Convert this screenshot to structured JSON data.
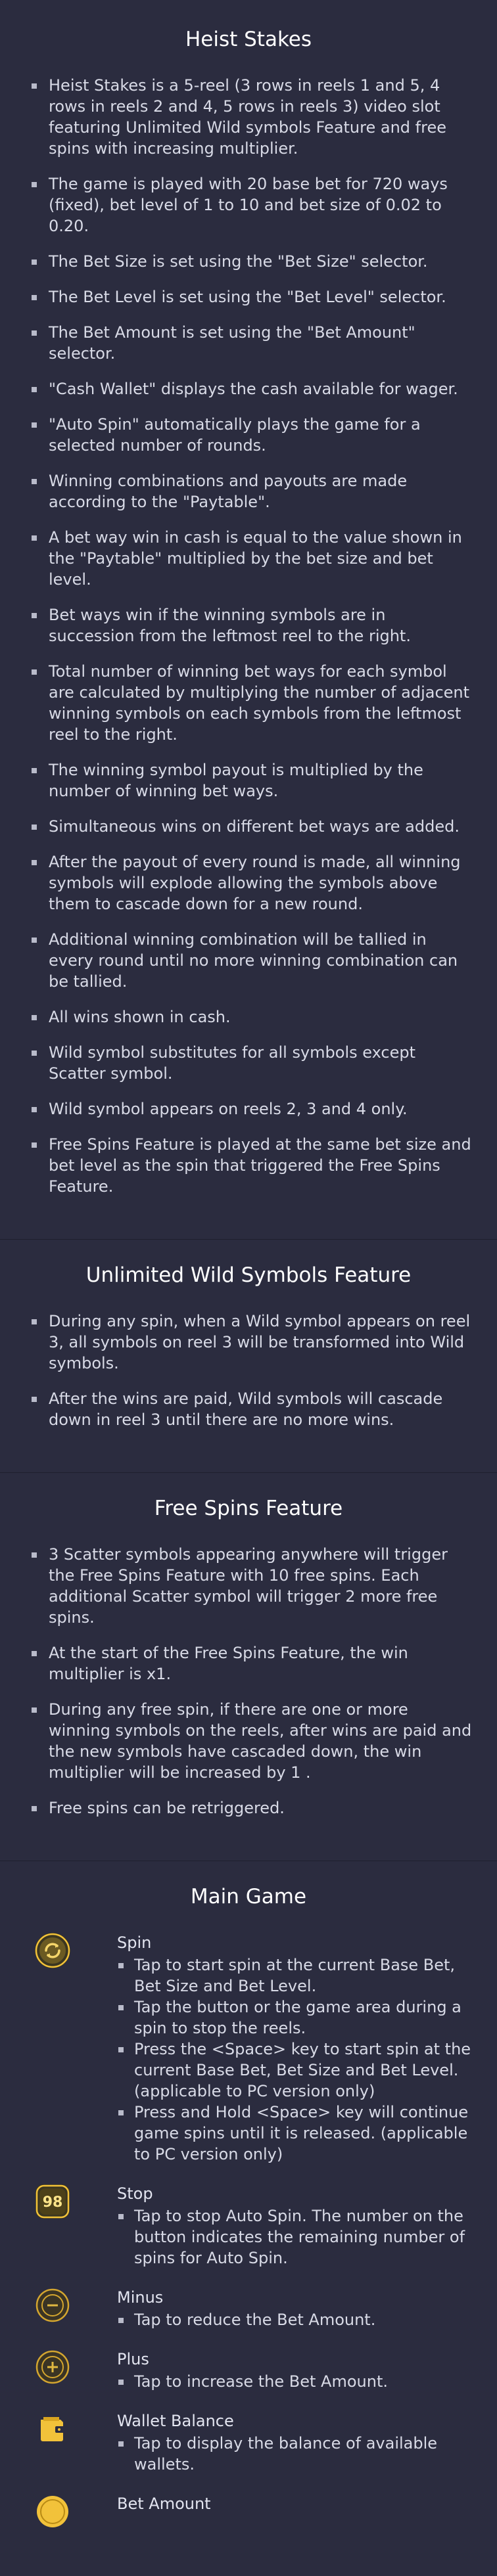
{
  "sections": {
    "heist_stakes": {
      "title": "Heist Stakes",
      "items": [
        "Heist Stakes is a 5-reel (3 rows in reels 1 and 5, 4 rows in reels 2 and 4, 5 rows in reels 3) video slot featuring Unlimited Wild symbols Feature and free spins with increasing multiplier.",
        "The game is played with 20 base bet for 720 ways (fixed), bet level of 1 to 10 and bet size of 0.02 to 0.20.",
        "The Bet Size is set using the \"Bet Size\" selector.",
        "The Bet Level is set using the \"Bet Level\" selector.",
        "The Bet Amount is set using the \"Bet Amount\" selector.",
        "\"Cash Wallet\" displays the cash available for wager.",
        "\"Auto Spin\" automatically plays the game for a selected number of rounds.",
        "Winning combinations and payouts are made according to the \"Paytable\".",
        "A bet way win in cash is equal to the value shown in the \"Paytable\" multiplied by the bet size and bet level.",
        "Bet ways win if the winning symbols are in succession from the leftmost reel to the right.",
        "Total number of winning bet ways for each symbol are calculated by multiplying the number of adjacent winning symbols on each symbols from the leftmost reel to the right.",
        "The winning symbol payout is multiplied by the number of winning bet ways.",
        "Simultaneous wins on different bet ways are added.",
        "After the payout of every round is made, all winning symbols will explode allowing the symbols above them to cascade down for a new round.",
        "Additional winning combination will be tallied in every round until no more winning combination can be tallied.",
        "All wins shown in cash.",
        "Wild symbol substitutes for all symbols except Scatter symbol.",
        "Wild symbol appears on reels 2, 3 and 4 only.",
        "Free Spins Feature is played at the same bet size and bet level as the spin that triggered the Free Spins Feature."
      ]
    },
    "unlimited_wild": {
      "title": "Unlimited Wild Symbols Feature",
      "items": [
        "During any spin, when a Wild symbol appears on reel 3, all symbols on reel 3 will be transformed into Wild symbols.",
        "After the wins are paid, Wild symbols will cascade down in reel 3 until there are no more wins."
      ]
    },
    "free_spins": {
      "title": "Free Spins Feature",
      "items": [
        "3 Scatter symbols appearing anywhere will trigger the Free Spins Feature with 10 free spins. Each additional Scatter symbol will trigger 2 more free spins.",
        "At the start of the Free Spins Feature, the win multiplier is x1.",
        "During any free spin, if there are one or more winning symbols on the reels, after wins are paid and the new symbols have cascaded down, the win multiplier will be increased by 1 .",
        "Free spins can be retriggered."
      ]
    },
    "main_game": {
      "title": "Main Game",
      "controls": [
        {
          "icon": "spin-icon",
          "name": "Spin",
          "items": [
            "Tap to start spin at the current Base Bet, Bet Size and Bet Level.",
            "Tap the button or the game area during a spin to stop the reels.",
            "Press the <Space> key to start spin at the current Base Bet, Bet Size and Bet Level. (applicable to PC version only)",
            "Press and Hold <Space> key will continue game spins until it is released. (applicable to PC version only)"
          ]
        },
        {
          "icon": "stop-autospin-icon",
          "badge": "98",
          "name": "Stop",
          "items": [
            "Tap to stop Auto Spin. The number on the button indicates the remaining number of spins for Auto Spin."
          ]
        },
        {
          "icon": "minus-icon",
          "name": "Minus",
          "items": [
            "Tap to reduce the Bet Amount."
          ]
        },
        {
          "icon": "plus-icon",
          "name": "Plus",
          "items": [
            "Tap to increase the Bet Amount."
          ]
        },
        {
          "icon": "wallet-icon",
          "name": "Wallet Balance",
          "items": [
            "Tap to display the balance of available wallets."
          ]
        },
        {
          "icon": "bet-amount-icon",
          "name": "Bet Amount",
          "items": []
        }
      ]
    }
  },
  "colors": {
    "background": "#2b2c3f",
    "text": "#d8dae6",
    "title": "#ffffff",
    "gold": "#f2c23a",
    "icon_dark": "#5a4718"
  }
}
